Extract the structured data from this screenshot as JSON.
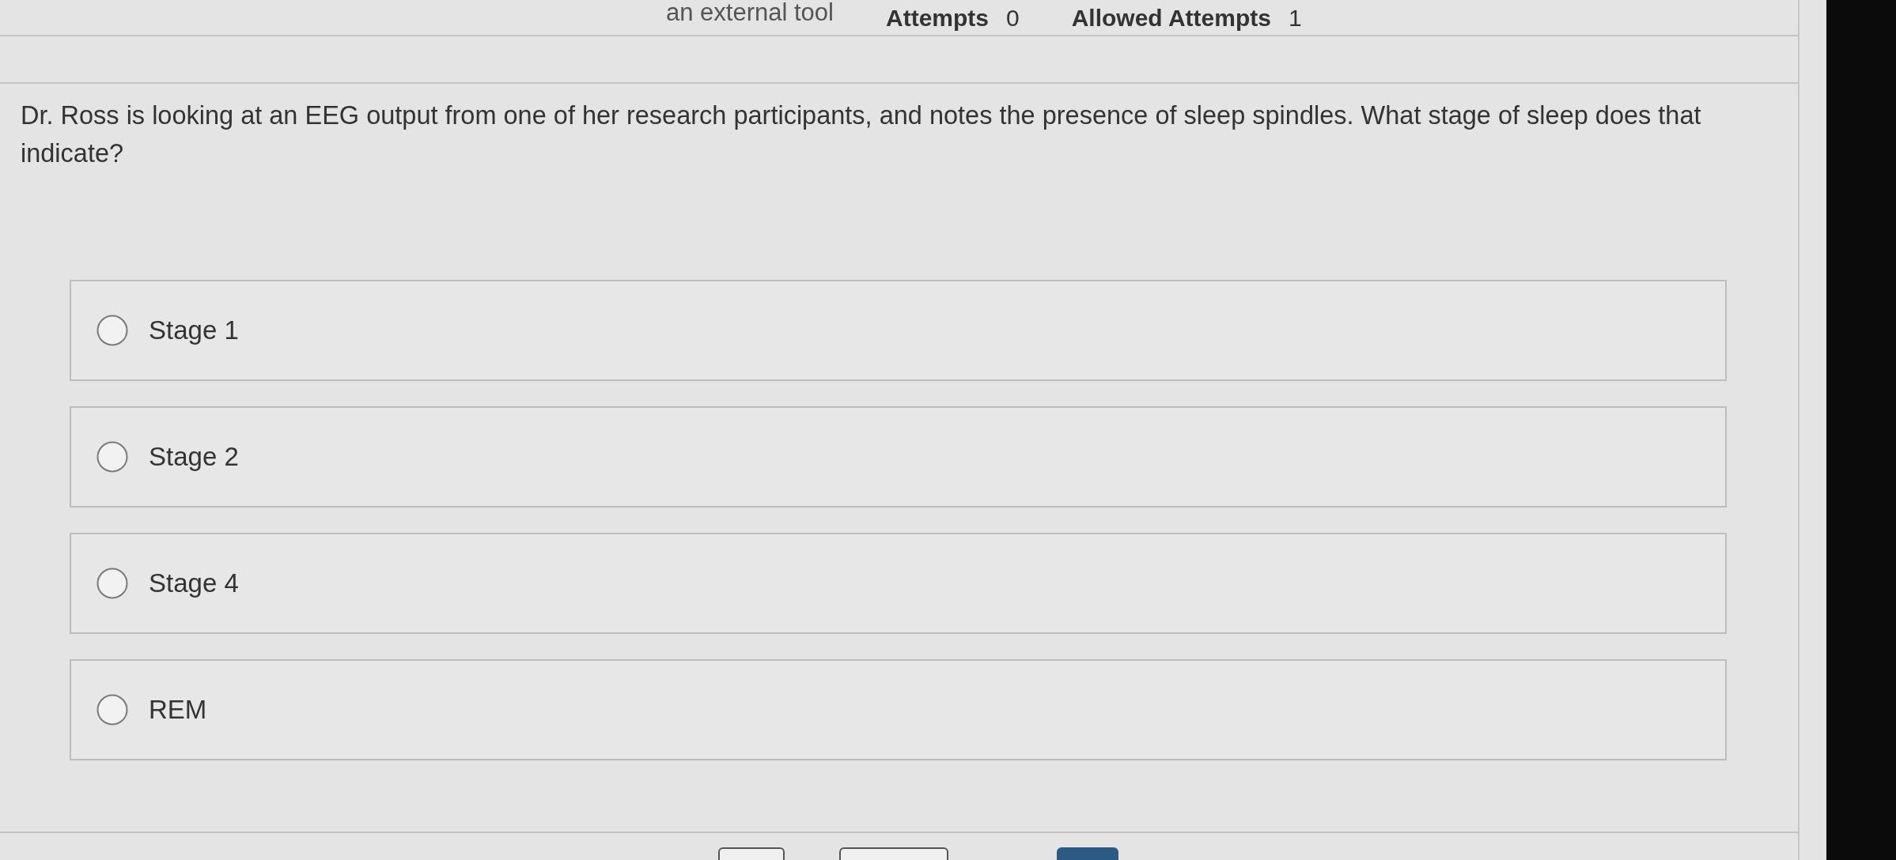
{
  "header": {
    "tool_caption": "an external tool",
    "attempts": {
      "label": "Attempts",
      "value": "0"
    },
    "allowed_attempts": {
      "label": "Allowed Attempts",
      "value": "1"
    }
  },
  "question": {
    "text": "Dr. Ross is looking at an EEG output from one of her research participants, and notes the presence of sleep spindles. What stage of sleep does that indicate?"
  },
  "options": [
    {
      "label": "Stage 1",
      "selected": false
    },
    {
      "label": "Stage 2",
      "selected": false
    },
    {
      "label": "Stage 4",
      "selected": false
    },
    {
      "label": "REM",
      "selected": false
    }
  ],
  "footer_buttons": [
    {
      "kind": "outlined"
    },
    {
      "kind": "outlined"
    },
    {
      "kind": "primary"
    }
  ]
}
